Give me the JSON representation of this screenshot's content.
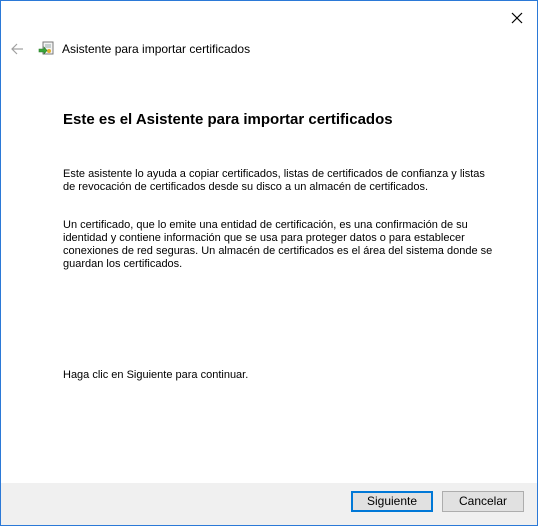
{
  "window": {
    "close_icon": "close-icon",
    "back_icon": "back-arrow-icon",
    "app_icon": "certificate-wizard-icon",
    "title": "Asistente para importar certificados",
    "accent_color": "#0078d7"
  },
  "content": {
    "heading": "Este es el Asistente para importar certificados",
    "paragraph1": "Este asistente lo ayuda a copiar certificados, listas de certificados de confianza y listas de revocación de certificados desde su disco a un almacén de certificados.",
    "paragraph2": "Un certificado, que lo emite una entidad de certificación, es una confirmación de su identidad y contiene información que se usa para proteger datos o para establecer conexiones de red seguras. Un almacén de certificados es el área del sistema donde se guardan los certificados.",
    "paragraph3": "Haga clic en Siguiente para continuar."
  },
  "footer": {
    "next_label": "Siguiente",
    "cancel_label": "Cancelar"
  }
}
